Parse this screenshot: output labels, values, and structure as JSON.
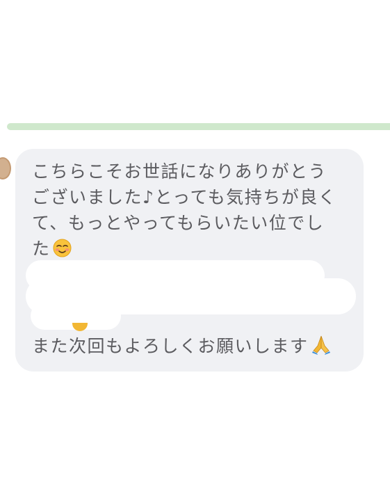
{
  "message": {
    "lines": [
      "こちらこそお世話になりありがとう",
      "ございました♪とっても気持ちが良く",
      "て、もっとやってもらいたい位でし",
      "た"
    ],
    "last_line": "また次回もよろしくお願いします",
    "emojis": [
      "smiling-face-icon",
      "folded-hands-icon"
    ]
  },
  "colors": {
    "bubble": "#f0f1f4",
    "text": "#5b5b5f",
    "divider": "#cfe8cc"
  }
}
